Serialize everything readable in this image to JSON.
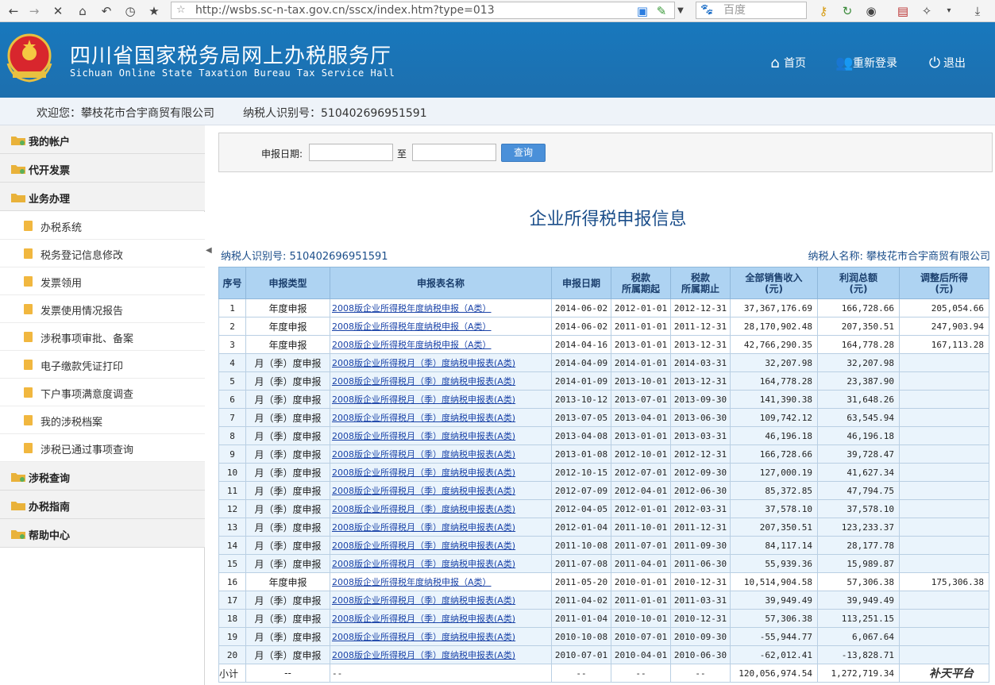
{
  "browser": {
    "url": "http://wsbs.sc-n-tax.gov.cn/sscx/index.htm?type=013",
    "search_placeholder": "百度"
  },
  "header": {
    "title": "四川省国家税务局网上办税服务厅",
    "subtitle": "Sichuan Online State Taxation Bureau Tax Service Hall",
    "nav": [
      "首页",
      "重新登录",
      "退出"
    ]
  },
  "welcome": {
    "greeting": "欢迎您：攀枝花市合宇商贸有限公司",
    "taxpayer_id": "纳税人识别号：510402696951591"
  },
  "sidebar": {
    "menus": [
      "我的帐户",
      "代开发票",
      "业务办理"
    ],
    "subitems": [
      "办税系统",
      "税务登记信息修改",
      "发票领用",
      "发票使用情况报告",
      "涉税事项审批、备案",
      "电子缴款凭证打印",
      "下户事项满意度调查",
      "我的涉税档案",
      "涉税已通过事项查询"
    ],
    "menus2": [
      "涉税查询",
      "办税指南",
      "帮助中心"
    ]
  },
  "search": {
    "date_label": "申报日期:",
    "to_label": "至",
    "query_button": "查询",
    "start_date": "",
    "end_date": ""
  },
  "report": {
    "title": "企业所得税申报信息",
    "taxpayer_id": "纳税人识别号: 510402696951591",
    "taxpayer_name": "纳税人名称: 攀枝花市合宇商贸有限公司"
  },
  "table": {
    "headers": [
      "序号",
      "申报类型",
      "申报表名称",
      "申报日期",
      "税款\n所属期起",
      "税款\n所属期止",
      "全部销售收入\n(元)",
      "利润总额\n(元)",
      "调整后所得\n(元)"
    ],
    "rows": [
      [
        "1",
        "年度申报",
        "2008版企业所得税年度纳税申报（A类）",
        "2014-06-02",
        "2012-01-01",
        "2012-12-31",
        "37,367,176.69",
        "166,728.66",
        "205,054.66"
      ],
      [
        "2",
        "年度申报",
        "2008版企业所得税年度纳税申报（A类）",
        "2014-06-02",
        "2011-01-01",
        "2011-12-31",
        "28,170,902.48",
        "207,350.51",
        "247,903.94"
      ],
      [
        "3",
        "年度申报",
        "2008版企业所得税年度纳税申报（A类）",
        "2014-04-16",
        "2013-01-01",
        "2013-12-31",
        "42,766,290.35",
        "164,778.28",
        "167,113.28"
      ],
      [
        "4",
        "月（季）度申报",
        "2008版企业所得税月（季）度纳税申报表(A类)",
        "2014-04-09",
        "2014-01-01",
        "2014-03-31",
        "32,207.98",
        "32,207.98",
        ""
      ],
      [
        "5",
        "月（季）度申报",
        "2008版企业所得税月（季）度纳税申报表(A类)",
        "2014-01-09",
        "2013-10-01",
        "2013-12-31",
        "164,778.28",
        "23,387.90",
        ""
      ],
      [
        "6",
        "月（季）度申报",
        "2008版企业所得税月（季）度纳税申报表(A类)",
        "2013-10-12",
        "2013-07-01",
        "2013-09-30",
        "141,390.38",
        "31,648.26",
        ""
      ],
      [
        "7",
        "月（季）度申报",
        "2008版企业所得税月（季）度纳税申报表(A类)",
        "2013-07-05",
        "2013-04-01",
        "2013-06-30",
        "109,742.12",
        "63,545.94",
        ""
      ],
      [
        "8",
        "月（季）度申报",
        "2008版企业所得税月（季）度纳税申报表(A类)",
        "2013-04-08",
        "2013-01-01",
        "2013-03-31",
        "46,196.18",
        "46,196.18",
        ""
      ],
      [
        "9",
        "月（季）度申报",
        "2008版企业所得税月（季）度纳税申报表(A类)",
        "2013-01-08",
        "2012-10-01",
        "2012-12-31",
        "166,728.66",
        "39,728.47",
        ""
      ],
      [
        "10",
        "月（季）度申报",
        "2008版企业所得税月（季）度纳税申报表(A类)",
        "2012-10-15",
        "2012-07-01",
        "2012-09-30",
        "127,000.19",
        "41,627.34",
        ""
      ],
      [
        "11",
        "月（季）度申报",
        "2008版企业所得税月（季）度纳税申报表(A类)",
        "2012-07-09",
        "2012-04-01",
        "2012-06-30",
        "85,372.85",
        "47,794.75",
        ""
      ],
      [
        "12",
        "月（季）度申报",
        "2008版企业所得税月（季）度纳税申报表(A类)",
        "2012-04-05",
        "2012-01-01",
        "2012-03-31",
        "37,578.10",
        "37,578.10",
        ""
      ],
      [
        "13",
        "月（季）度申报",
        "2008版企业所得税月（季）度纳税申报表(A类)",
        "2012-01-04",
        "2011-10-01",
        "2011-12-31",
        "207,350.51",
        "123,233.37",
        ""
      ],
      [
        "14",
        "月（季）度申报",
        "2008版企业所得税月（季）度纳税申报表(A类)",
        "2011-10-08",
        "2011-07-01",
        "2011-09-30",
        "84,117.14",
        "28,177.78",
        ""
      ],
      [
        "15",
        "月（季）度申报",
        "2008版企业所得税月（季）度纳税申报表(A类)",
        "2011-07-08",
        "2011-04-01",
        "2011-06-30",
        "55,939.36",
        "15,989.87",
        ""
      ],
      [
        "16",
        "年度申报",
        "2008版企业所得税年度纳税申报（A类）",
        "2011-05-20",
        "2010-01-01",
        "2010-12-31",
        "10,514,904.58",
        "57,306.38",
        "175,306.38"
      ],
      [
        "17",
        "月（季）度申报",
        "2008版企业所得税月（季）度纳税申报表(A类)",
        "2011-04-02",
        "2011-01-01",
        "2011-03-31",
        "39,949.49",
        "39,949.49",
        ""
      ],
      [
        "18",
        "月（季）度申报",
        "2008版企业所得税月（季）度纳税申报表(A类)",
        "2011-01-04",
        "2010-10-01",
        "2010-12-31",
        "57,306.38",
        "113,251.15",
        ""
      ],
      [
        "19",
        "月（季）度申报",
        "2008版企业所得税月（季）度纳税申报表(A类)",
        "2010-10-08",
        "2010-07-01",
        "2010-09-30",
        "-55,944.77",
        "6,067.64",
        ""
      ],
      [
        "20",
        "月（季）度申报",
        "2008版企业所得税月（季）度纳税申报表(A类)",
        "2010-07-01",
        "2010-04-01",
        "2010-06-30",
        "-62,012.41",
        "-13,828.71",
        ""
      ]
    ],
    "subtotal": [
      "小计",
      "--",
      "--",
      "--",
      "--",
      "--",
      "120,056,974.54",
      "1,272,719.34",
      ""
    ]
  },
  "watermark": "补天平台",
  "colors": {
    "header_blue": "#1878bd",
    "table_header": "#aed3f2",
    "link": "#1a43a8"
  }
}
